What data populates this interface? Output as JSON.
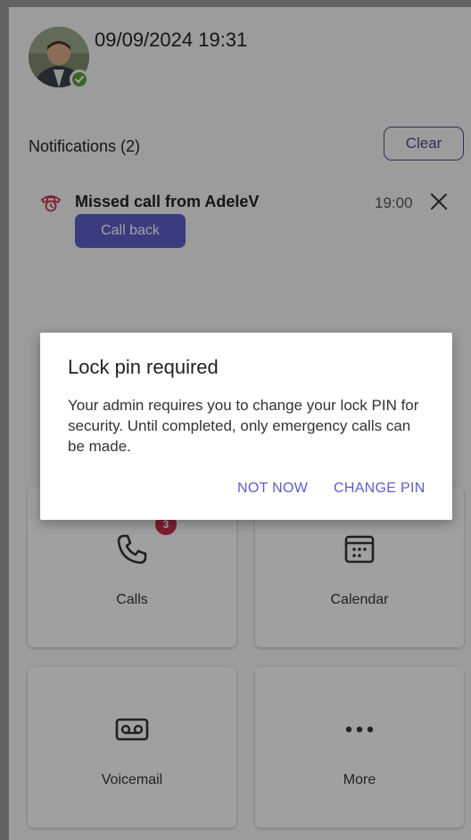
{
  "header": {
    "datetime": "09/09/2024 19:31",
    "presence": "available"
  },
  "notifications": {
    "title": "Notifications (2)",
    "clear_label": "Clear",
    "items": [
      {
        "icon": "missed-call-icon",
        "text": "Missed call from AdeleV",
        "time": "19:00",
        "action_label": "Call back"
      }
    ]
  },
  "tiles": [
    {
      "label": "Calls",
      "icon": "phone-icon",
      "badge": "3"
    },
    {
      "label": "Calendar",
      "icon": "calendar-icon"
    },
    {
      "label": "Voicemail",
      "icon": "voicemail-icon"
    },
    {
      "label": "More",
      "icon": "more-icon"
    }
  ],
  "dialog": {
    "title": "Lock pin required",
    "body": "Your admin requires you to change your lock PIN for security. Until completed, only emergency calls can be made.",
    "secondary_label": "NOT NOW",
    "primary_label": "CHANGE PIN"
  },
  "colors": {
    "accent": "#5b5fc7",
    "missed": "#c4314b",
    "presence": "#5a9e3a",
    "badge": "#c4314b"
  }
}
